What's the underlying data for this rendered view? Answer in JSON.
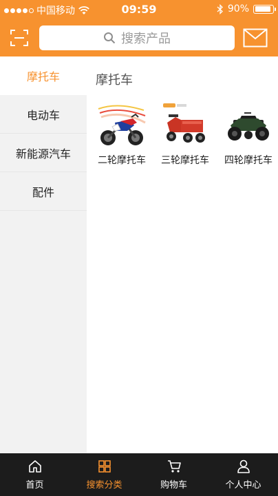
{
  "status_bar": {
    "carrier": "中国移动",
    "time": "09:59",
    "battery": "90%",
    "battery_level": 0.9,
    "signal_dots_filled": 4,
    "signal_dots_total": 5
  },
  "header": {
    "search_placeholder": "搜索产品",
    "scan_icon": "scan-icon",
    "mail_icon": "mail-icon"
  },
  "sidebar": {
    "items": [
      {
        "label": "摩托车",
        "active": true
      },
      {
        "label": "电动车",
        "active": false
      },
      {
        "label": "新能源汽车",
        "active": false
      },
      {
        "label": "配件",
        "active": false
      }
    ]
  },
  "main": {
    "section_title": "摩托车",
    "products": [
      {
        "name": "二轮摩托车",
        "icon": "motorcycle-image"
      },
      {
        "name": "三轮摩托车",
        "icon": "tricycle-image"
      },
      {
        "name": "四轮摩托车",
        "icon": "atv-image"
      }
    ]
  },
  "tabbar": {
    "tabs": [
      {
        "label": "首页",
        "icon": "home-icon",
        "active": false
      },
      {
        "label": "搜索分类",
        "icon": "category-icon",
        "active": true
      },
      {
        "label": "购物车",
        "icon": "cart-icon",
        "active": false
      },
      {
        "label": "个人中心",
        "icon": "user-icon",
        "active": false
      }
    ]
  },
  "colors": {
    "accent": "#f7922f",
    "tabbar_bg": "#1c1c1c",
    "sidebar_bg": "#f2f2f2"
  }
}
